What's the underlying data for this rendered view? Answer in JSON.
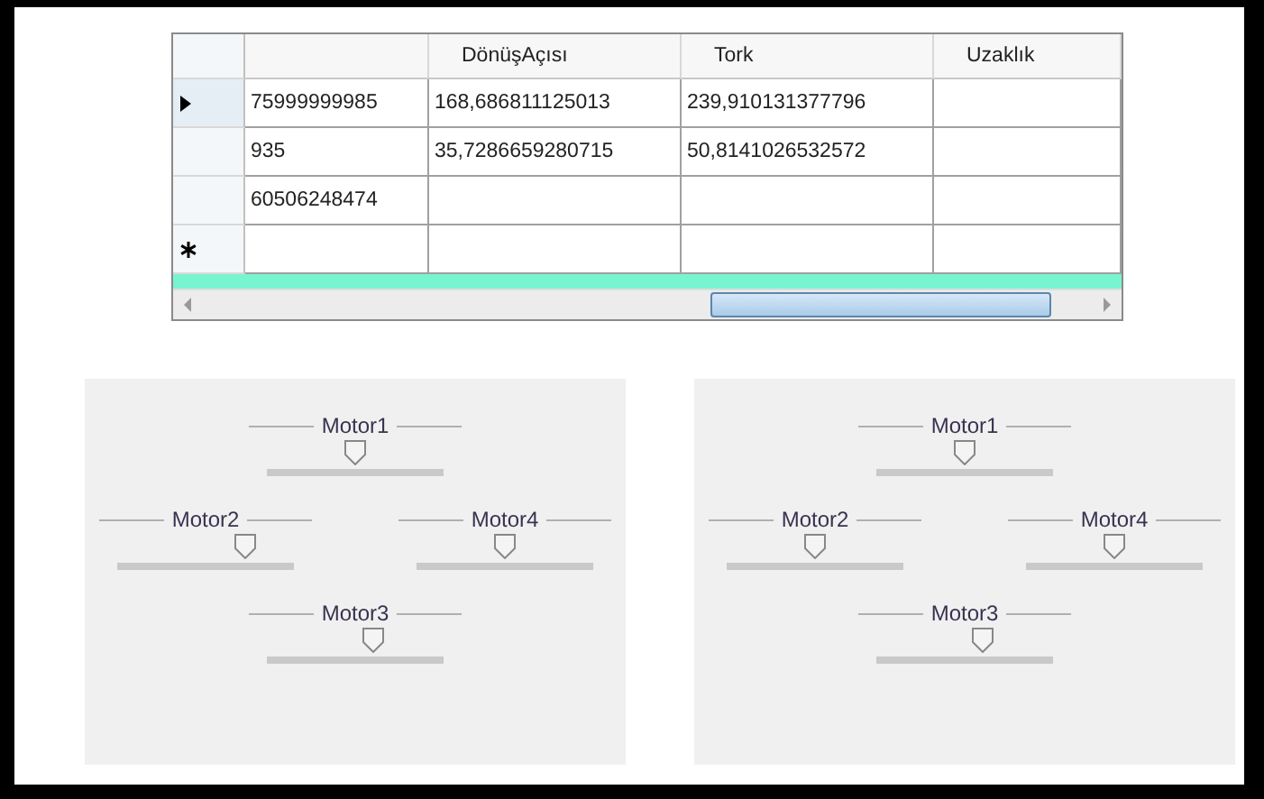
{
  "grid": {
    "column_headers": [
      "DönüşAçısı",
      "Tork",
      "Uzaklık"
    ],
    "rows": [
      {
        "kind": "data",
        "selected": true,
        "cells": [
          "75999999985",
          "168,686811125013",
          "239,910131377796"
        ]
      },
      {
        "kind": "data",
        "selected": false,
        "cells": [
          "935",
          "35,7286659280715",
          "50,8141026532572"
        ]
      },
      {
        "kind": "data",
        "selected": false,
        "cells": [
          "60506248474"
        ]
      },
      {
        "kind": "new",
        "selected": false,
        "cells": []
      }
    ]
  },
  "panels": [
    {
      "motors": [
        {
          "label": "Motor1",
          "level": 0.5
        },
        {
          "label": "Motor2",
          "level": 0.72
        },
        {
          "label": "Motor4",
          "level": 0.5
        },
        {
          "label": "Motor3",
          "level": 0.6
        }
      ]
    },
    {
      "motors": [
        {
          "label": "Motor1",
          "level": 0.5
        },
        {
          "label": "Motor2",
          "level": 0.5
        },
        {
          "label": "Motor4",
          "level": 0.5
        },
        {
          "label": "Motor3",
          "level": 0.6
        }
      ]
    }
  ]
}
